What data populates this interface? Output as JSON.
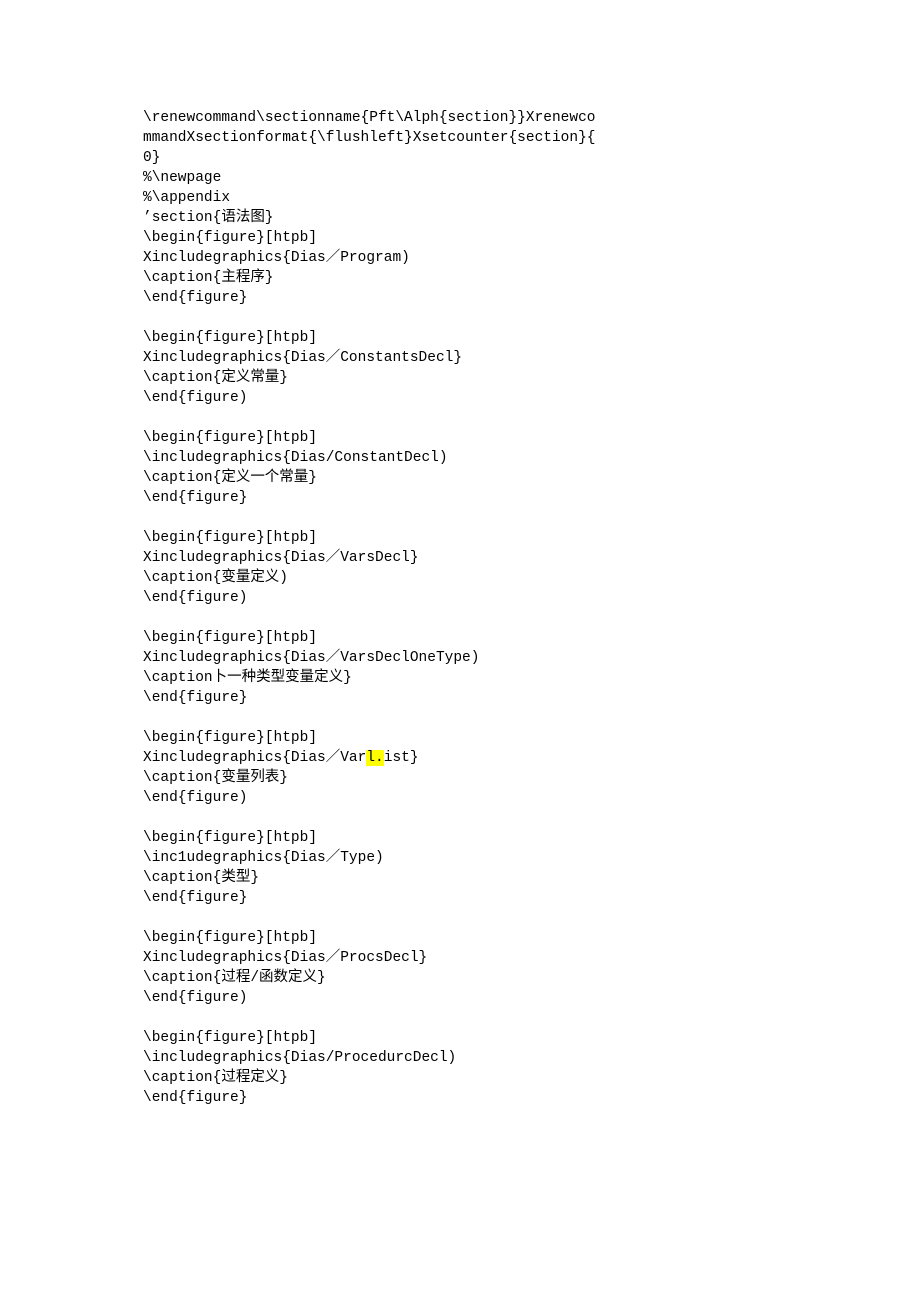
{
  "blocks": [
    {
      "id": "b0",
      "lines": [
        {
          "id": "l0",
          "segs": [
            {
              "t": "\\renewcommand\\sectionname{Pft\\Alph{section}}Xrenewco"
            }
          ]
        },
        {
          "id": "l1",
          "segs": [
            {
              "t": "mmandXsectionformat{\\flushleft}Xsetcounter{section}{"
            }
          ]
        },
        {
          "id": "l2",
          "segs": [
            {
              "t": "0}"
            }
          ]
        },
        {
          "id": "l3",
          "segs": [
            {
              "t": "%\\newpage"
            }
          ]
        },
        {
          "id": "l4",
          "segs": [
            {
              "t": "%\\appendix"
            }
          ]
        },
        {
          "id": "l5",
          "segs": [
            {
              "t": "’section{语法图}"
            }
          ]
        },
        {
          "id": "l6",
          "segs": [
            {
              "t": "\\begin{figure}[htpb]"
            }
          ]
        },
        {
          "id": "l7",
          "segs": [
            {
              "t": "Xincludegraphics{Dias／Program)"
            }
          ]
        },
        {
          "id": "l8",
          "segs": [
            {
              "t": "\\caption{主程序}"
            }
          ]
        },
        {
          "id": "l9",
          "segs": [
            {
              "t": "\\end{figure}"
            }
          ]
        }
      ]
    },
    {
      "id": "b1",
      "lines": [
        {
          "id": "l10",
          "segs": [
            {
              "t": "\\begin{figure}[htpb]"
            }
          ]
        },
        {
          "id": "l11",
          "segs": [
            {
              "t": "Xincludegraphics{Dias／ConstantsDecl}"
            }
          ]
        },
        {
          "id": "l12",
          "segs": [
            {
              "t": "\\caption{定义常量}"
            }
          ]
        },
        {
          "id": "l13",
          "segs": [
            {
              "t": "\\end{figure)"
            }
          ]
        }
      ]
    },
    {
      "id": "b2",
      "lines": [
        {
          "id": "l14",
          "segs": [
            {
              "t": "\\begin{figure}[htpb]"
            }
          ]
        },
        {
          "id": "l15",
          "segs": [
            {
              "t": "\\includegraphics{Dias/ConstantDecl)"
            }
          ]
        },
        {
          "id": "l16",
          "segs": [
            {
              "t": "\\caption{定义一个常量}"
            }
          ]
        },
        {
          "id": "l17",
          "segs": [
            {
              "t": "\\end{figure}"
            }
          ]
        }
      ]
    },
    {
      "id": "b3",
      "lines": [
        {
          "id": "l18",
          "segs": [
            {
              "t": "\\begin{figure}[htpb]"
            }
          ]
        },
        {
          "id": "l19",
          "segs": [
            {
              "t": "Xincludegraphics{Dias／VarsDecl}"
            }
          ]
        },
        {
          "id": "l20",
          "segs": [
            {
              "t": "\\caption{变量定义)"
            }
          ]
        },
        {
          "id": "l21",
          "segs": [
            {
              "t": "\\end{figure)"
            }
          ]
        }
      ]
    },
    {
      "id": "b4",
      "lines": [
        {
          "id": "l22",
          "segs": [
            {
              "t": "\\begin{figure}[htpb]"
            }
          ]
        },
        {
          "id": "l23",
          "segs": [
            {
              "t": "Xincludegraphics{Dias／VarsDeclOneType)"
            }
          ]
        },
        {
          "id": "l24",
          "segs": [
            {
              "t": "\\caption卜一种类型变量定义}"
            }
          ]
        },
        {
          "id": "l25",
          "segs": [
            {
              "t": "\\end{figure}"
            }
          ]
        }
      ]
    },
    {
      "id": "b5",
      "lines": [
        {
          "id": "l26",
          "segs": [
            {
              "t": "\\begin{figure}[htpb]"
            }
          ]
        },
        {
          "id": "l27",
          "segs": [
            {
              "t": "Xincludegraphics{Dias／Var"
            },
            {
              "t": "l.",
              "hl": true
            },
            {
              "t": "ist}"
            }
          ]
        },
        {
          "id": "l28",
          "segs": [
            {
              "t": "\\caption{变量列表}"
            }
          ]
        },
        {
          "id": "l29",
          "segs": [
            {
              "t": "\\end{figure)"
            }
          ]
        }
      ]
    },
    {
      "id": "b6",
      "lines": [
        {
          "id": "l30",
          "segs": [
            {
              "t": "\\begin{figure}[htpb]"
            }
          ]
        },
        {
          "id": "l31",
          "segs": [
            {
              "t": "\\inc1udegraphics{Dias／Type)"
            }
          ]
        },
        {
          "id": "l32",
          "segs": [
            {
              "t": "\\caption{类型}"
            }
          ]
        },
        {
          "id": "l33",
          "segs": [
            {
              "t": "\\end{figure}"
            }
          ]
        }
      ]
    },
    {
      "id": "b7",
      "lines": [
        {
          "id": "l34",
          "segs": [
            {
              "t": "\\begin{figure}[htpb]"
            }
          ]
        },
        {
          "id": "l35",
          "segs": [
            {
              "t": "Xincludegraphics{Dias／ProcsDecl}"
            }
          ]
        },
        {
          "id": "l36",
          "segs": [
            {
              "t": "\\caption{过程/函数定义}"
            }
          ]
        },
        {
          "id": "l37",
          "segs": [
            {
              "t": "\\end{figure)"
            }
          ]
        }
      ]
    },
    {
      "id": "b8",
      "lines": [
        {
          "id": "l38",
          "segs": [
            {
              "t": "\\begin{figure}[htpb]"
            }
          ]
        },
        {
          "id": "l39",
          "segs": [
            {
              "t": "\\includegraphics{Dias/ProcedurcDecl)"
            }
          ]
        },
        {
          "id": "l40",
          "segs": [
            {
              "t": "\\caption{过程定义}"
            }
          ]
        },
        {
          "id": "l41",
          "segs": [
            {
              "t": "\\end{figure}"
            }
          ]
        }
      ]
    }
  ]
}
